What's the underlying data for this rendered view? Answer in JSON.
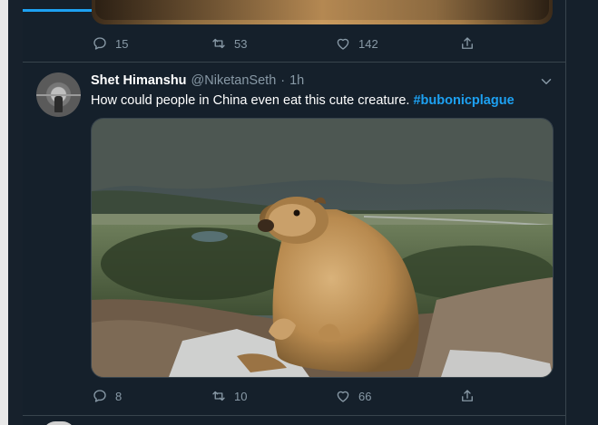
{
  "previous_tweet": {
    "actions": {
      "reply_count": "15",
      "retweet_count": "53",
      "like_count": "142"
    }
  },
  "tweet": {
    "display_name": "Shet Himanshu",
    "handle": "@NiketanSeth",
    "separator": "·",
    "time": "1h",
    "text": "How could people in China even eat this cute creature.",
    "hashtag": "#bubonicplague",
    "actions": {
      "reply_count": "8",
      "retweet_count": "10",
      "like_count": "66"
    }
  },
  "colors": {
    "background": "#15202b",
    "accent": "#1da1f2",
    "muted": "#8899a6",
    "border": "#38444d"
  },
  "icons": [
    "reply-icon",
    "retweet-icon",
    "like-icon",
    "share-icon",
    "chevron-down-icon"
  ]
}
